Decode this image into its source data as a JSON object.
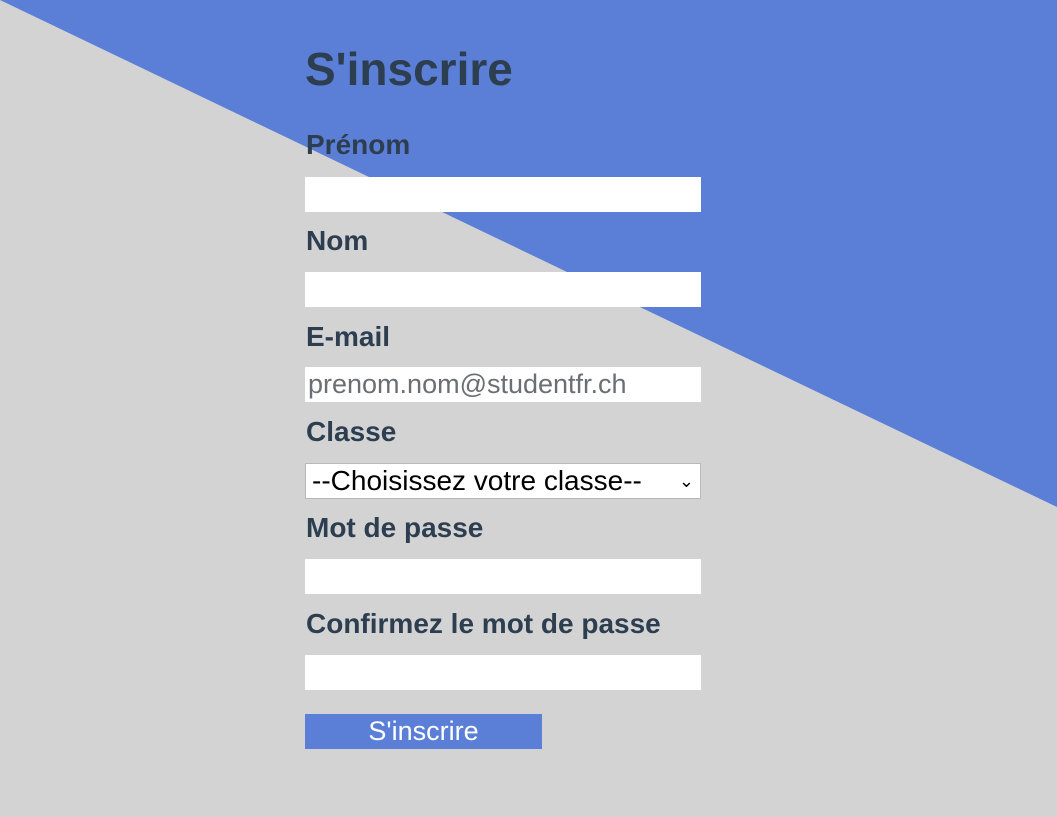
{
  "colors": {
    "background": "#d3d3d3",
    "accent": "#5b7fd6",
    "text": "#2c3e50"
  },
  "form": {
    "title": "S'inscrire",
    "fields": {
      "first_name": {
        "label": "Prénom",
        "value": "",
        "placeholder": ""
      },
      "last_name": {
        "label": "Nom",
        "value": "",
        "placeholder": ""
      },
      "email": {
        "label": "E-mail",
        "value": "",
        "placeholder": "prenom.nom@studentfr.ch"
      },
      "class": {
        "label": "Classe",
        "selected": "--Choisissez votre classe--"
      },
      "password": {
        "label": "Mot de passe",
        "value": "",
        "placeholder": ""
      },
      "confirm_password": {
        "label": "Confirmez le mot de passe",
        "value": "",
        "placeholder": ""
      }
    },
    "submit_label": "S'inscrire"
  },
  "icons": {
    "select_chevron": "chevron-down-icon"
  }
}
